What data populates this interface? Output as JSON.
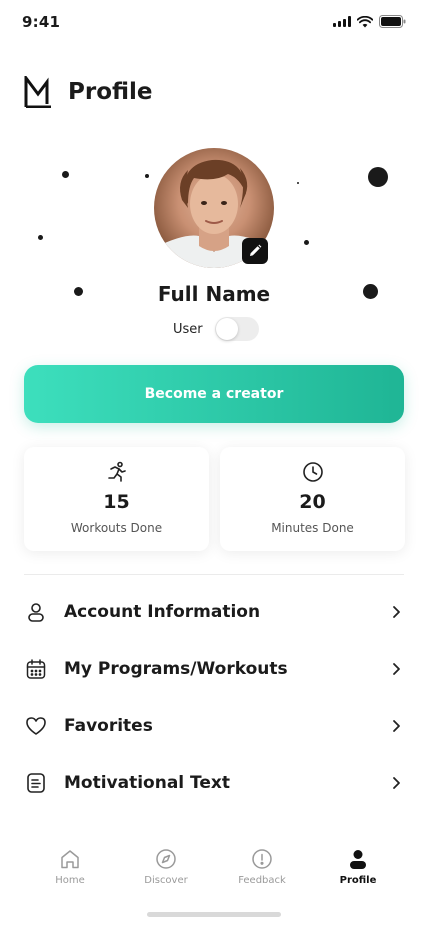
{
  "status_bar": {
    "time": "9:41"
  },
  "header": {
    "title": "Profile",
    "logo_icon": "brand-m-logo"
  },
  "profile": {
    "name": "Full Name",
    "role_label": "User",
    "role_toggle_on": false,
    "edit_icon": "pencil-icon"
  },
  "cta": {
    "label": "Become a creator",
    "gradient": [
      "#3ddfbd",
      "#1fb595"
    ]
  },
  "stats": [
    {
      "icon": "running-icon",
      "value": "15",
      "label": "Workouts Done"
    },
    {
      "icon": "clock-icon",
      "value": "20",
      "label": "Minutes Done"
    }
  ],
  "menu": [
    {
      "icon": "user-icon",
      "label": "Account Information"
    },
    {
      "icon": "calendar-icon",
      "label": "My Programs/Workouts"
    },
    {
      "icon": "heart-icon",
      "label": "Favorites"
    },
    {
      "icon": "document-icon",
      "label": "Motivational Text"
    }
  ],
  "tabs": [
    {
      "icon": "home-icon",
      "label": "Home",
      "active": false
    },
    {
      "icon": "compass-icon",
      "label": "Discover",
      "active": false
    },
    {
      "icon": "alert-circle-icon",
      "label": "Feedback",
      "active": false
    },
    {
      "icon": "person-icon",
      "label": "Profile",
      "active": true
    }
  ]
}
